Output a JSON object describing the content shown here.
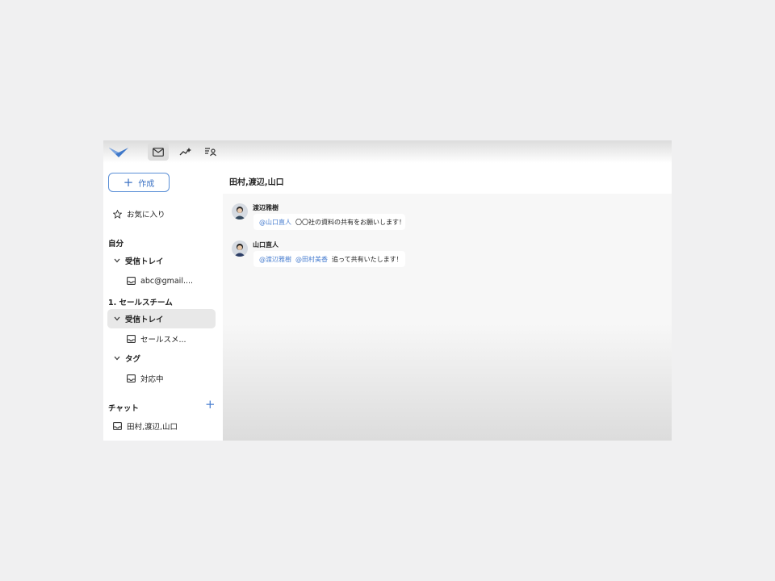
{
  "sidebar": {
    "compose_label": "作成",
    "favorites_label": "お気に入り",
    "section_self": "自分",
    "self_inbox_label": "受信トレイ",
    "self_account_label": "abc@gmail....",
    "section_team": "1. セールスチーム",
    "team_inbox_label": "受信トレイ",
    "team_account_label": "セールスメ...",
    "tags_label": "タグ",
    "tag_item_label": "対応中",
    "chat_section_label": "チャット",
    "chat_item_label": "田村,渡辺,山口"
  },
  "main": {
    "title": "田村,渡辺,山口",
    "messages": [
      {
        "sender": "渡辺雅樹",
        "mentions": [
          "@山口直人"
        ],
        "text": "〇〇社の資料の共有をお願いします！"
      },
      {
        "sender": "山口直人",
        "mentions": [
          "@渡辺雅樹",
          "@田村美香"
        ],
        "text": "追って共有いたします！"
      }
    ]
  },
  "colors": {
    "accent": "#4a7fd0",
    "selected_bg": "#e8e8e8",
    "page_bg": "#f0f0f1"
  },
  "icons": [
    "logo-icon",
    "mail-icon",
    "analytics-icon",
    "contacts-icon",
    "plus-icon",
    "star-icon",
    "chevron-down-icon",
    "inbox-tray-icon"
  ]
}
